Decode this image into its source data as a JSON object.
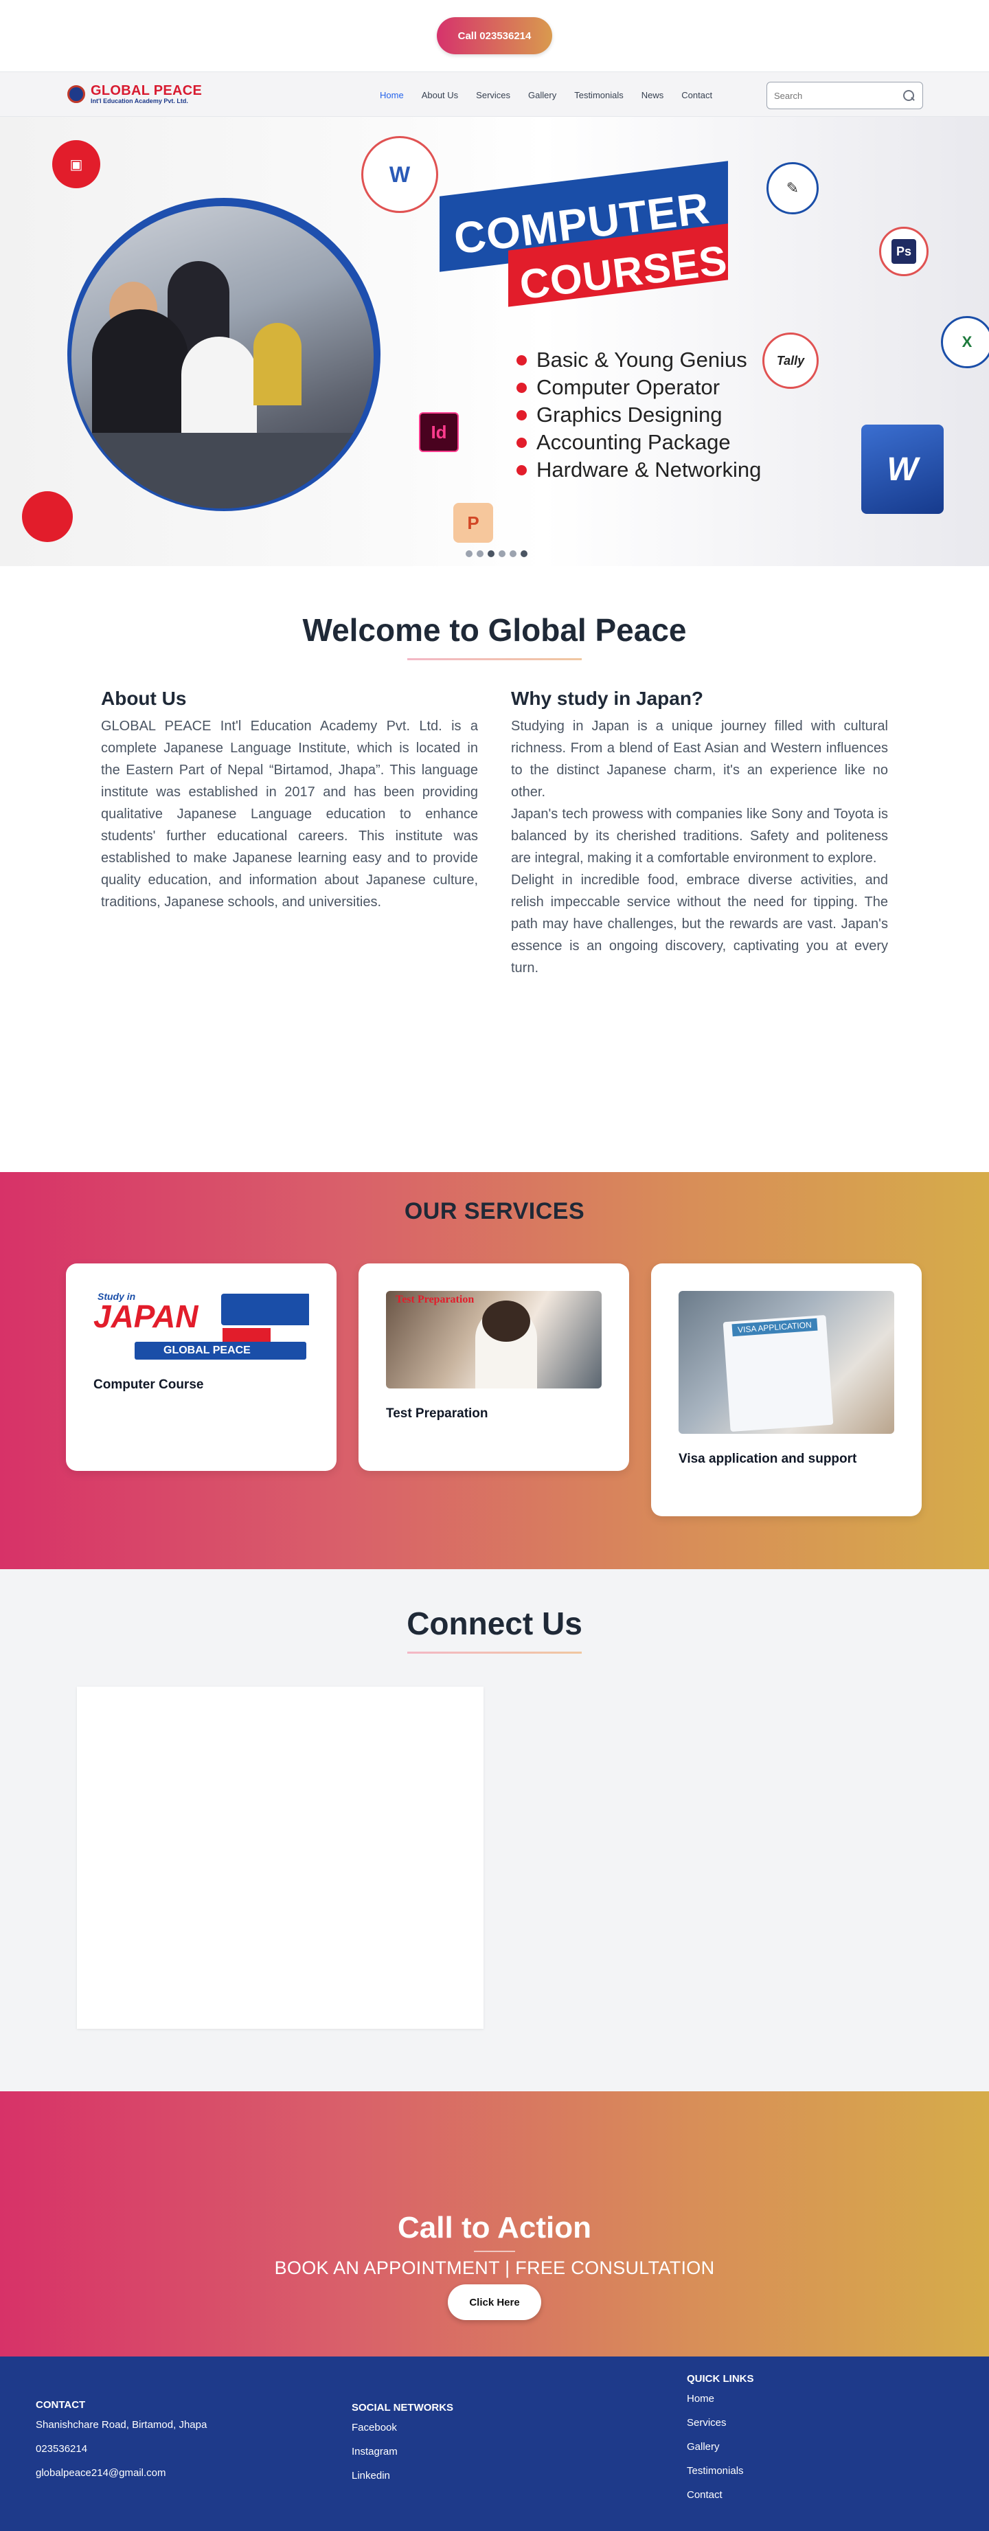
{
  "topbar": {
    "call_label": "Call 023536214"
  },
  "nav": {
    "logo_line1": "GLOBAL PEACE",
    "logo_line2": "Int'l Education Academy Pvt. Ltd.",
    "items": [
      "Home",
      "About Us",
      "Services",
      "Gallery",
      "Testimonials",
      "News",
      "Contact"
    ],
    "active": "Home",
    "search_placeholder": "Search"
  },
  "hero": {
    "banner_line1": "COMPUTER",
    "banner_line2": "COURSES",
    "courses": [
      "Basic & Young Genius",
      "Computer Operator",
      "Graphics Designing",
      "Accounting Package",
      "Hardware & Networking"
    ],
    "icons": [
      "word-icon",
      "photoshop-icon",
      "excel-icon",
      "tally-icon",
      "indesign-icon",
      "powerpoint-icon",
      "coreldraw-icon"
    ],
    "slide_count": 6,
    "active_slide": 3
  },
  "welcome": {
    "title": "Welcome to Global Peace",
    "about_heading": "About Us",
    "about_text": "GLOBAL PEACE Int'l Education Academy Pvt. Ltd. is a complete Japanese Language Institute, which is located in the Eastern Part of Nepal “Birtamod, Jhapa”. This language institute was established in 2017 and has been providing qualitative Japanese Language education to enhance students' further educational careers. This institute was established to make Japanese learning easy and to provide quality education, and information about Japanese culture, traditions, Japanese schools, and universities.",
    "japan_heading": "Why study in Japan?",
    "japan_p1": "Studying in Japan is a unique journey filled with cultural richness. From a blend of East Asian and Western influences to the distinct Japanese charm, it's an experience like no other.",
    "japan_p2": "Japan's tech prowess with companies like Sony and Toyota is balanced by its cherished traditions. Safety and politeness are integral, making it a comfortable environment to explore.",
    "japan_p3": "Delight in incredible food, embrace diverse activities, and relish impeccable service without the need for tipping. The path may have challenges, but the rewards are vast. Japan's essence is an ongoing discovery, captivating you at every turn."
  },
  "services": {
    "title": "OUR SERVICES",
    "cards": [
      {
        "title": "Computer Course",
        "img_text1": "Study in",
        "img_text2": "JAPAN",
        "img_text3": "GLOBAL PEACE"
      },
      {
        "title": "Test Preparation",
        "img_text1": "Test Preparation"
      },
      {
        "title": "Visa application and support",
        "img_text1": "VISA APPLICATION"
      }
    ]
  },
  "connect": {
    "title": "Connect Us"
  },
  "cta": {
    "title": "Call to Action",
    "subtitle": "BOOK AN APPOINTMENT | FREE CONSULTATION",
    "button": "Click Here"
  },
  "footer": {
    "contact": {
      "heading": "CONTACT",
      "address": "Shanishchare Road, Birtamod, Jhapa",
      "phone": "023536214",
      "email": "globalpeace214@gmail.com"
    },
    "social": {
      "heading": "SOCIAL NETWORKS",
      "links": [
        "Facebook",
        "Instagram",
        "Linkedin"
      ]
    },
    "quick": {
      "heading": "QUICK LINKS",
      "links": [
        "Home",
        "Services",
        "Gallery",
        "Testimonials",
        "Contact"
      ]
    }
  },
  "colors": {
    "brand_red": "#e21d2b",
    "brand_blue": "#1e3a8a",
    "gradient_start": "#d73268",
    "gradient_end": "#d6ac4a",
    "nav_active": "#2563eb"
  }
}
